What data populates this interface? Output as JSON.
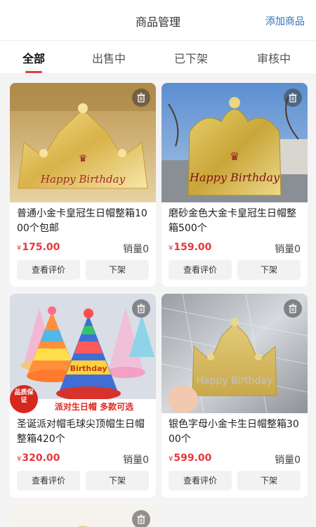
{
  "header": {
    "title": "商品管理",
    "add_label": "添加商品"
  },
  "tabs": [
    {
      "label": "全部",
      "active": true
    },
    {
      "label": "出售中",
      "active": false
    },
    {
      "label": "已下架",
      "active": false
    },
    {
      "label": "审核中",
      "active": false
    }
  ],
  "colors": {
    "accent": "#e43d3d",
    "price": "#e4393c",
    "link": "#2f6fb8"
  },
  "products": [
    {
      "name": "普通小金卡皇冠生日帽整箱1000个包邮",
      "currency": "¥",
      "price": "175.00",
      "sales": "销量0",
      "review_label": "查看评价",
      "offshelf_label": "下架",
      "image_text": "Happy Birthday"
    },
    {
      "name": "磨砂金色大金卡皇冠生日帽整箱500个",
      "currency": "¥",
      "price": "159.00",
      "sales": "销量0",
      "review_label": "查看评价",
      "offshelf_label": "下架",
      "image_text": "Happy Birthday"
    },
    {
      "name": "圣诞派对帽毛球尖顶帽生日帽整箱420个",
      "currency": "¥",
      "price": "320.00",
      "sales": "销量0",
      "review_label": "查看评价",
      "offshelf_label": "下架",
      "image_text": "Birthday",
      "badge": "品质保证",
      "banner": "派对生日帽 多款可选"
    },
    {
      "name": "银色字母小金卡生日帽整箱3000个",
      "currency": "¥",
      "price": "599.00",
      "sales": "销量0",
      "review_label": "查看评价",
      "offshelf_label": "下架",
      "image_text": "Happy Birthday"
    }
  ],
  "icons": {
    "delete": "trash-icon"
  }
}
